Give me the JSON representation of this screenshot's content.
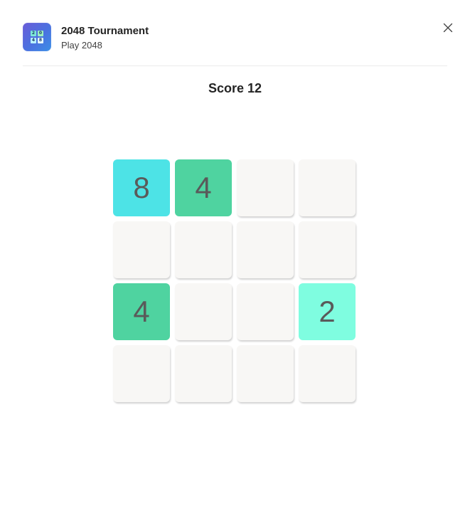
{
  "header": {
    "title": "2048 Tournament",
    "subtitle": "Play 2048",
    "app_icon_tiles": [
      "2",
      "0",
      "4",
      "8"
    ],
    "close_icon": "close-icon"
  },
  "score": {
    "label": "Score",
    "value": "12"
  },
  "board": {
    "rows": [
      [
        "8",
        "4",
        "",
        ""
      ],
      [
        "",
        "",
        "",
        ""
      ],
      [
        "4",
        "",
        "",
        "2"
      ],
      [
        "",
        "",
        "",
        ""
      ]
    ]
  },
  "colors": {
    "empty": "#f8f7f5",
    "tile_2": "#7ffde0",
    "tile_4": "#4fd3a0",
    "tile_8": "#4de3e6",
    "text": "#242424",
    "tile_text": "#5a5a5a"
  }
}
